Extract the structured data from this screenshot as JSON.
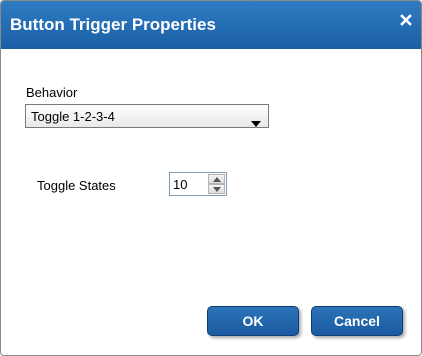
{
  "dialog": {
    "title": "Button Trigger Properties",
    "close_icon": "close-icon"
  },
  "behavior": {
    "label": "Behavior",
    "selected": "Toggle 1-2-3-4",
    "dropdown_icon": "chevron-down-icon"
  },
  "toggle_states": {
    "label": "Toggle States",
    "value": "10",
    "up_icon": "spin-up-icon",
    "down_icon": "spin-down-icon"
  },
  "buttons": {
    "ok_label": "OK",
    "cancel_label": "Cancel"
  },
  "colors": {
    "titlebar": "#1f6db4",
    "button": "#2166ad"
  }
}
